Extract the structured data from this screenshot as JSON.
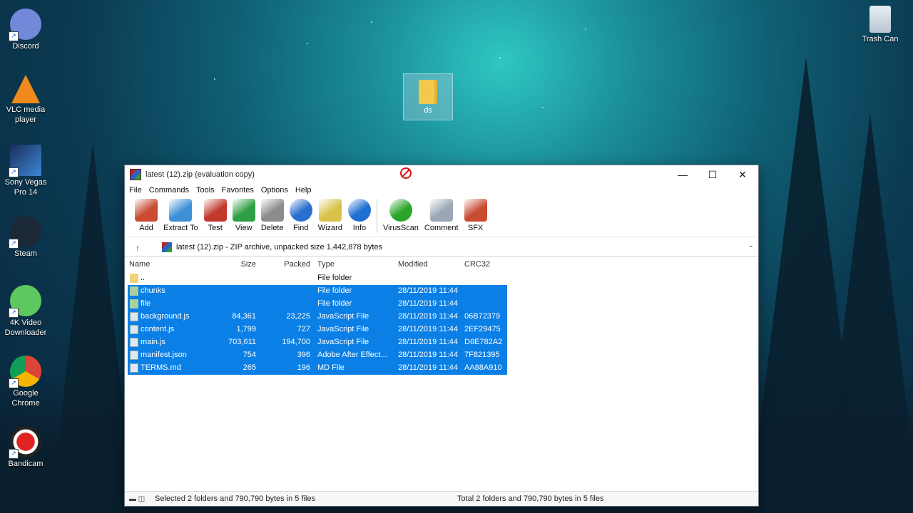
{
  "desktop": {
    "icons": [
      {
        "label": "Discord"
      },
      {
        "label": "VLC media player"
      },
      {
        "label": "Sony Vegas Pro 14"
      },
      {
        "label": "Steam"
      },
      {
        "label": "4K Video Downloader"
      },
      {
        "label": "Google Chrome"
      },
      {
        "label": "Bandicam"
      }
    ],
    "trash_label": "Trash Can",
    "folder_label": "ds"
  },
  "window": {
    "title": "latest (12).zip (evaluation copy)",
    "controls": {
      "minimize": "—",
      "maximize": "☐",
      "close": "✕"
    }
  },
  "menu": [
    "File",
    "Commands",
    "Tools",
    "Favorites",
    "Options",
    "Help"
  ],
  "toolbar": [
    {
      "label": "Add",
      "icon": "add-icon",
      "color": "#c84b32"
    },
    {
      "label": "Extract To",
      "icon": "extract-folder-icon",
      "color": "#3f8fd6"
    },
    {
      "label": "Test",
      "icon": "test-checklist-icon",
      "color": "#c0392b"
    },
    {
      "label": "View",
      "icon": "view-book-icon",
      "color": "#2f9e44"
    },
    {
      "label": "Delete",
      "icon": "delete-trash-icon",
      "color": "#8c8c8c"
    },
    {
      "label": "Find",
      "icon": "find-magnifier-icon",
      "color": "#2a6fcf"
    },
    {
      "label": "Wizard",
      "icon": "wizard-wand-icon",
      "color": "#d9c24a"
    },
    {
      "label": "Info",
      "icon": "info-icon",
      "color": "#1f6fd1"
    },
    {
      "label": "VirusScan",
      "icon": "virusscan-icon",
      "color": "#2aa52a"
    },
    {
      "label": "Comment",
      "icon": "comment-icon",
      "color": "#9aa8b5"
    },
    {
      "label": "SFX",
      "icon": "sfx-icon",
      "color": "#c84b32"
    }
  ],
  "path": {
    "up_arrow": "↑",
    "text": "latest (12).zip - ZIP archive, unpacked size 1,442,878 bytes",
    "chevron": "⌄"
  },
  "columns": {
    "name": "Name",
    "size": "Size",
    "packed": "Packed",
    "type": "Type",
    "modified": "Modified",
    "crc": "CRC32"
  },
  "files": [
    {
      "name": "..",
      "size": "",
      "packed": "",
      "type": "File folder",
      "modified": "",
      "crc": "",
      "kind": "folder",
      "selected": false
    },
    {
      "name": "chunks",
      "size": "",
      "packed": "",
      "type": "File folder",
      "modified": "28/11/2019 11:44",
      "crc": "",
      "kind": "folder",
      "selected": true
    },
    {
      "name": "file",
      "size": "",
      "packed": "",
      "type": "File folder",
      "modified": "28/11/2019 11:44",
      "crc": "",
      "kind": "folder",
      "selected": true
    },
    {
      "name": "background.js",
      "size": "84,361",
      "packed": "23,225",
      "type": "JavaScript File",
      "modified": "28/11/2019 11:44",
      "crc": "06B72379",
      "kind": "file",
      "selected": true
    },
    {
      "name": "content.js",
      "size": "1,799",
      "packed": "727",
      "type": "JavaScript File",
      "modified": "28/11/2019 11:44",
      "crc": "2EF29475",
      "kind": "file",
      "selected": true
    },
    {
      "name": "main.js",
      "size": "703,611",
      "packed": "194,700",
      "type": "JavaScript File",
      "modified": "28/11/2019 11:44",
      "crc": "D6E782A2",
      "kind": "file",
      "selected": true
    },
    {
      "name": "manifest.json",
      "size": "754",
      "packed": "396",
      "type": "Adobe After Effect...",
      "modified": "28/11/2019 11:44",
      "crc": "7F821395",
      "kind": "file",
      "selected": true
    },
    {
      "name": "TERMS.md",
      "size": "265",
      "packed": "196",
      "type": "MD File",
      "modified": "28/11/2019 11:44",
      "crc": "AA88A910",
      "kind": "file",
      "selected": true
    }
  ],
  "status": {
    "left": "Selected 2 folders and 790,790 bytes in 5 files",
    "right": "Total 2 folders and 790,790 bytes in 5 files"
  }
}
